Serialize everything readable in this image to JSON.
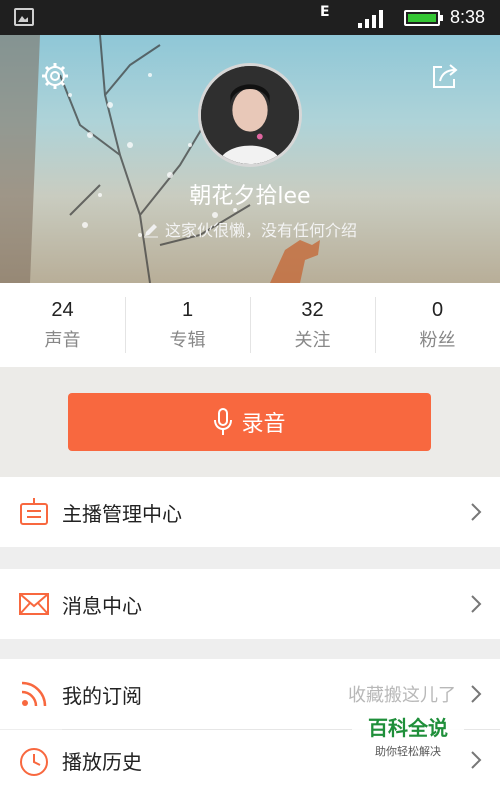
{
  "status_bar": {
    "network": "E",
    "time": "8:38"
  },
  "profile": {
    "nickname": "朝花夕拾lee",
    "bio": "这家伙很懒，没有任何介绍"
  },
  "stats": [
    {
      "value": "24",
      "label": "声音"
    },
    {
      "value": "1",
      "label": "专辑"
    },
    {
      "value": "32",
      "label": "关注"
    },
    {
      "value": "0",
      "label": "粉丝"
    }
  ],
  "record_button": {
    "label": "录音"
  },
  "menu": [
    {
      "label": "主播管理中心",
      "icon": "anchor-center-icon"
    },
    {
      "label": "消息中心",
      "icon": "mail-icon"
    },
    {
      "label": "我的订阅",
      "hint": "收藏搬这儿了",
      "icon": "rss-icon"
    },
    {
      "label": "播放历史",
      "icon": "clock-icon"
    }
  ],
  "watermark": {
    "title": "百科全说",
    "subtitle": "助你轻松解决"
  },
  "colors": {
    "accent": "#f8683f",
    "battery": "#34c633"
  }
}
